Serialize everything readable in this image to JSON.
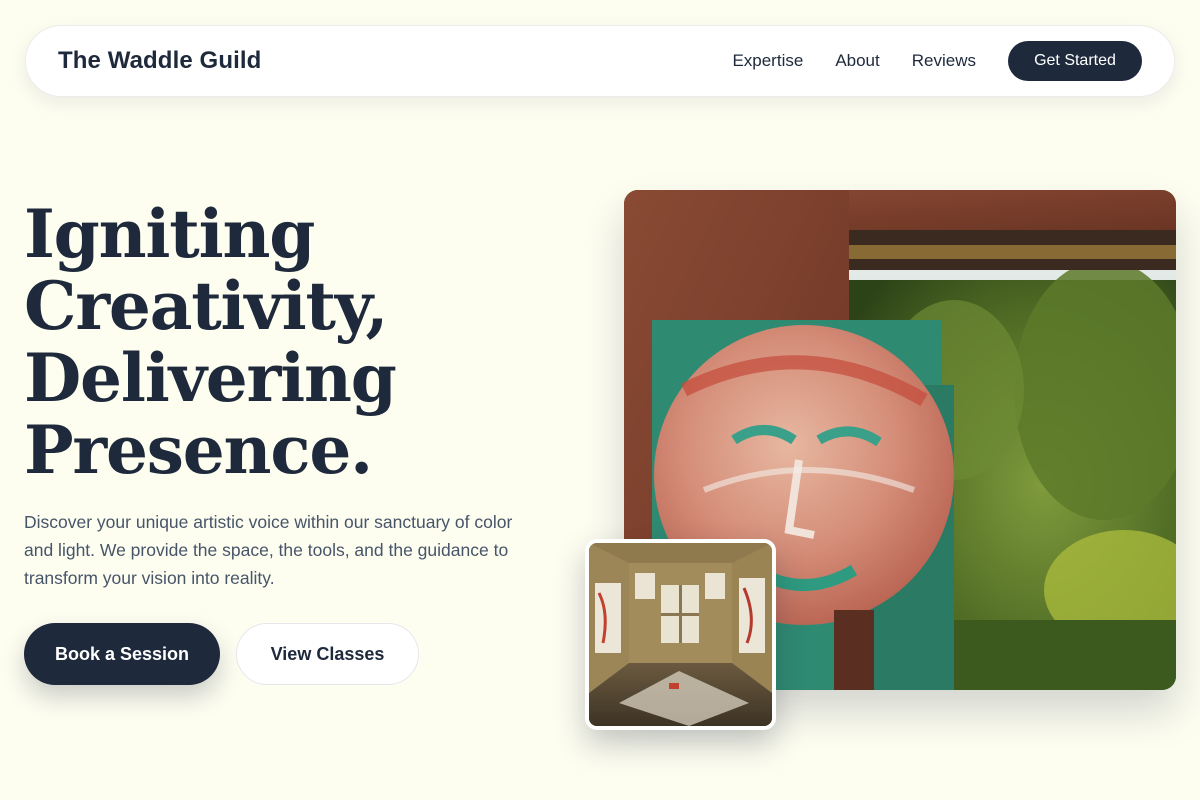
{
  "navbar": {
    "brand": "The Waddle Guild",
    "links": [
      "Expertise",
      "About",
      "Reviews"
    ],
    "cta_label": "Get Started"
  },
  "hero": {
    "headline_lines": [
      "Igniting",
      "Creativity,",
      "Delivering",
      "Presence."
    ],
    "description": "Discover your unique artistic voice within our sanctuary of color and light. We provide the space, the tools, and the guidance to transform your vision into reality.",
    "primary_button": "Book a Session",
    "secondary_button": "View Classes"
  },
  "colors": {
    "background": "#fdfdf0",
    "accent": "#1e293b",
    "body_text": "#475569"
  },
  "images": {
    "main": "painted-face-mural-photo",
    "inset": "art-studio-interior-photo"
  }
}
